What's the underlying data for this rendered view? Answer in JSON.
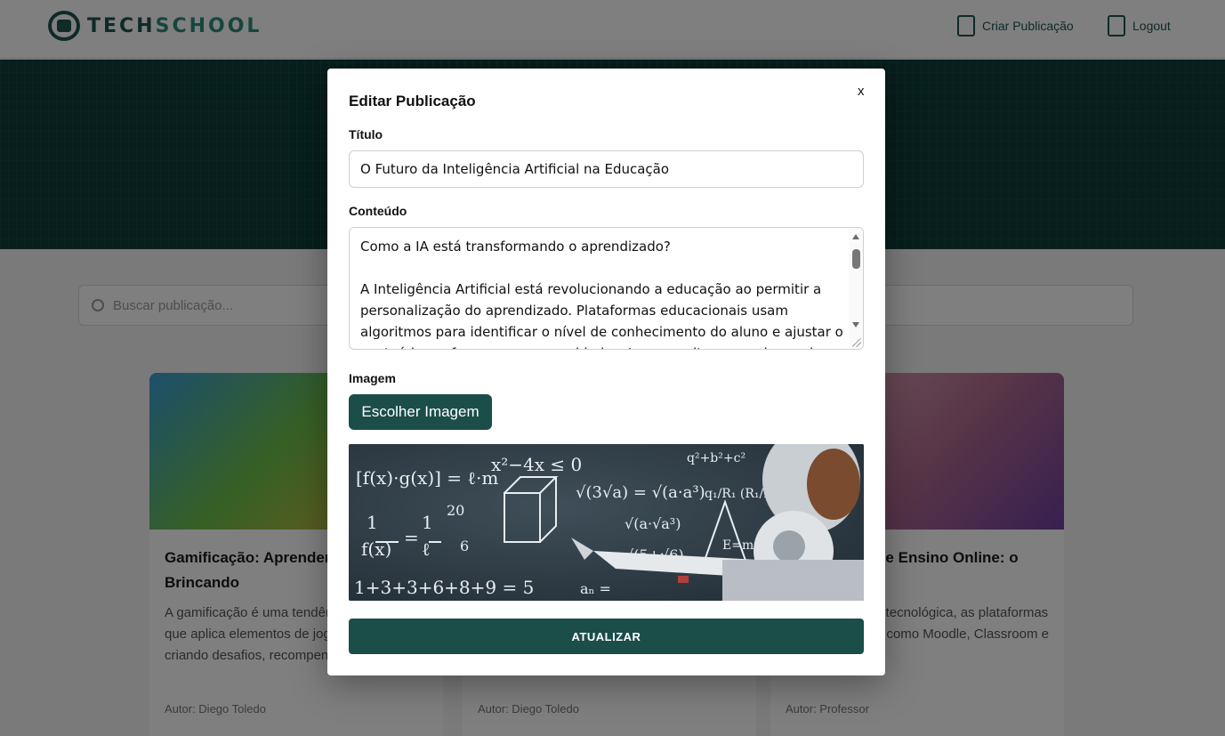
{
  "header": {
    "brand_part1": "TECH",
    "brand_part2": "SCHOOL",
    "create_label": "Criar Publicação",
    "logout_label": "Logout"
  },
  "search": {
    "placeholder": "Buscar publicação..."
  },
  "cards": [
    {
      "title": "Gamificação: Aprendendo Brincando",
      "excerpt": "A gamificação é uma tendência educacional que aplica elementos de jogos ao ensino, criando desafios, recompensas e...",
      "author": "Autor: Diego Toledo"
    },
    {
      "title": "",
      "excerpt": "",
      "author": "Autor: Diego Toledo"
    },
    {
      "title": "Plataformas de Ensino Online: o Futuro",
      "excerpt": "Com a evolução tecnológica, as plataformas de ensino online como Moodle, Classroom e edX...",
      "author": "Autor: Professor"
    }
  ],
  "modal": {
    "title": "Editar Publicação",
    "close_label": "x",
    "title_label": "Título",
    "title_value": "O Futuro da Inteligência Artificial na Educação",
    "content_label": "Conteúdo",
    "content_value": "Como a IA está transformando o aprendizado?\n\nA Inteligência Artificial está revolucionando a educação ao permitir a personalização do aprendizado. Plataformas educacionais usam algoritmos para identificar o nível de conhecimento do aluno e ajustar o conteúdo conforme suas necessidades. Isso permite um ensino mais eficiente e adaptado ao ritmo de cada estudante.",
    "image_label": "Imagem",
    "choose_label": "Escolher Imagem",
    "submit_label": "ATUALIZAR"
  },
  "colors": {
    "primary": "#1b4d49",
    "hero": "#0f3d38",
    "overlay": "rgba(0,0,0,0.5)",
    "chalkboard": "#2c3a44"
  },
  "icons": [
    "logo-icon",
    "document-icon",
    "logout-icon",
    "search-icon",
    "close-icon"
  ]
}
